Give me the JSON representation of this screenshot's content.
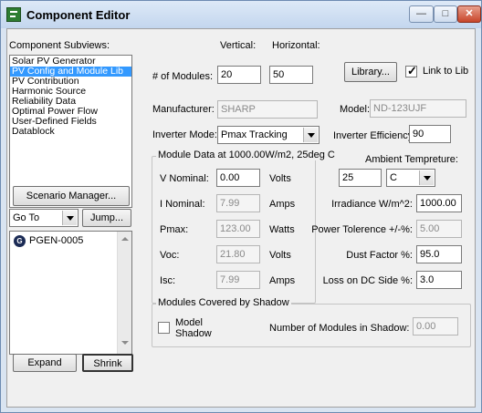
{
  "window": {
    "title": "Component Editor"
  },
  "subviews": {
    "label": "Component Subviews:",
    "items": [
      {
        "label": "Solar PV Generator",
        "selected": false
      },
      {
        "label": "PV Config and Module Lib",
        "selected": true
      },
      {
        "label": "PV Contribution",
        "selected": false
      },
      {
        "label": "Harmonic Source",
        "selected": false
      },
      {
        "label": "Reliability Data",
        "selected": false
      },
      {
        "label": "Optimal Power Flow",
        "selected": false
      },
      {
        "label": "User-Defined Fields",
        "selected": false
      },
      {
        "label": "Datablock",
        "selected": false
      }
    ]
  },
  "scenario_button": "Scenario Manager...",
  "goto": {
    "value": "Go To",
    "jump_label": "Jump..."
  },
  "tree": {
    "items": [
      {
        "label": "PGEN-0005",
        "icon": "generator-icon"
      }
    ]
  },
  "expand_label": "Expand",
  "shrink_label": "Shrink",
  "config": {
    "vertical_label": "Vertical:",
    "horizontal_label": "Horizontal:",
    "modules_label": "# of Modules:",
    "vertical_value": "20",
    "horizontal_value": "50",
    "library_button": "Library...",
    "link_label": "Link to Lib",
    "link_checked": true,
    "manufacturer_label": "Manufacturer:",
    "manufacturer_value": "SHARP",
    "model_label": "Model:",
    "model_value": "ND-123UJF",
    "inverter_mode_label": "Inverter Mode:",
    "inverter_mode_value": "Pmax Tracking",
    "inverter_eff_label": "Inverter Efficiency",
    "inverter_eff_value": "90"
  },
  "module_data": {
    "title": "Module Data at 1000.00W/m2, 25deg C",
    "rows": [
      {
        "label": "V Nominal:",
        "value": "0.00",
        "unit": "Volts",
        "disabled": false
      },
      {
        "label": "I Nominal:",
        "value": "7.99",
        "unit": "Amps",
        "disabled": true
      },
      {
        "label": "Pmax:",
        "value": "123.00",
        "unit": "Watts",
        "disabled": true
      },
      {
        "label": "Voc:",
        "value": "21.80",
        "unit": "Volts",
        "disabled": true
      },
      {
        "label": "Isc:",
        "value": "7.99",
        "unit": "Amps",
        "disabled": true
      }
    ]
  },
  "ambient": {
    "label": "Ambient Tempreture:",
    "value": "25",
    "unit": "C"
  },
  "right_fields": [
    {
      "label": "Irradiance W/m^2:",
      "value": "1000.00",
      "disabled": false
    },
    {
      "label": "Power Tolerence +/-%:",
      "value": "5.00",
      "disabled": true
    },
    {
      "label": "Dust Factor %:",
      "value": "95.0",
      "disabled": false
    },
    {
      "label": "Loss on DC Side %:",
      "value": "3.0",
      "disabled": false
    }
  ],
  "shadow": {
    "title": "Modules Covered by Shadow",
    "model_shadow_label1": "Model",
    "model_shadow_label2": "Shadow",
    "model_shadow_checked": false,
    "count_label": "Number of Modules in Shadow:",
    "count_value": "0.00"
  },
  "colors": {
    "selection": "#3399ff",
    "title_gradient_top": "#dde9f7",
    "close_button": "#c7452a"
  }
}
